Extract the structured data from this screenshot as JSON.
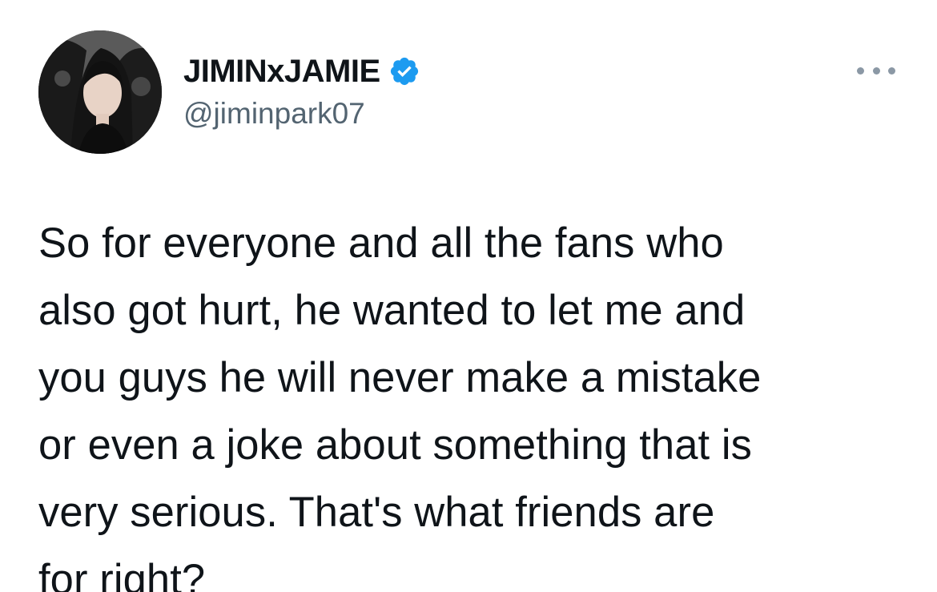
{
  "tweet": {
    "author": {
      "display_name": "JIMINxJAMIE",
      "handle": "@jiminpark07",
      "verified": true,
      "verified_badge_icon": "verified-badge-icon",
      "avatar_icon": "profile-photo"
    },
    "more_icon": "more-options-icon",
    "text": "So for everyone and all the fans who\nalso got hurt, he wanted to let me and\nyou guys he will never make a mistake\nor even a joke about something that is\nvery serious. That's what friends are\nfor right?"
  },
  "colors": {
    "text_primary": "#0f1419",
    "text_secondary": "#536471",
    "verified_blue": "#1d9bf0",
    "background": "#ffffff"
  }
}
